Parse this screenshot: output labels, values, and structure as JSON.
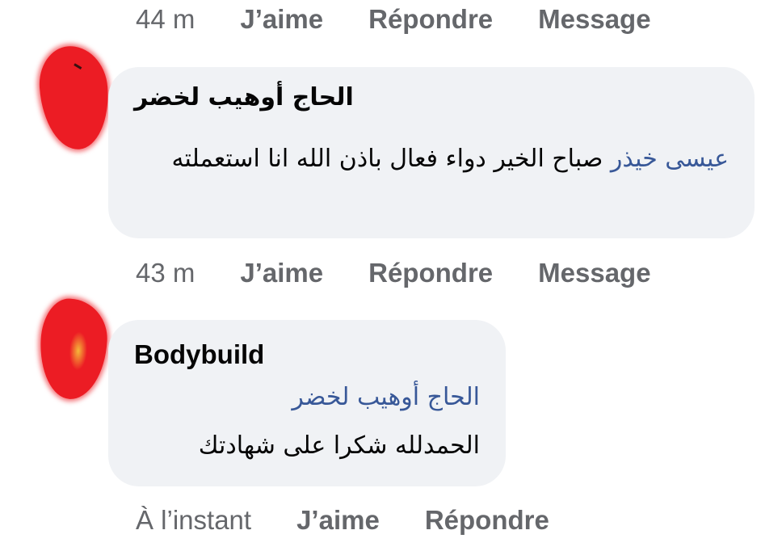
{
  "comments": [
    {
      "time": "",
      "actions": [
        "J’aime",
        "Répondre",
        "Message"
      ]
    },
    {
      "author": "الحاج أوهيب لخضر",
      "mention": "عيسى خيذر",
      "text": "صباح الخير دواء فعال باذن الله انا استعملته",
      "time": "43 m",
      "actions": [
        "J’aime",
        "Répondre",
        "Message"
      ]
    },
    {
      "author": "Bodybuild",
      "mention": "الحاج أوهيب لخضر",
      "text": "الحمدلله شكرا على شهادتك",
      "time": "À l’instant",
      "actions": [
        "J’aime",
        "Répondre"
      ]
    }
  ],
  "top_time": "44 m",
  "colors": {
    "mention": "#385898",
    "meta": "#65676b",
    "bubble": "#f0f2f5",
    "avatar_redaction": "#ec1c24"
  }
}
